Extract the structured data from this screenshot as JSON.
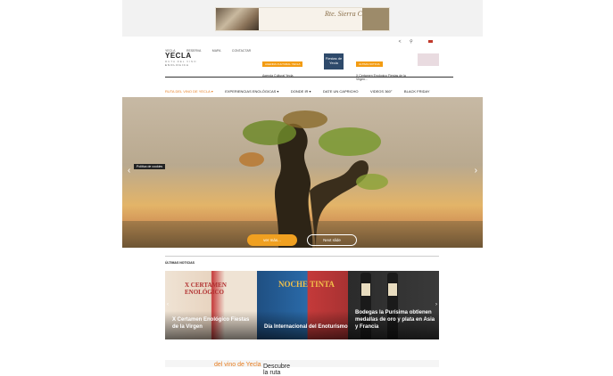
{
  "ad": {
    "title": "Rte. Sierra Cazorla",
    "subtitle": "",
    "logo_text": ""
  },
  "topnav": [
    "YECLA",
    "RESERVA",
    "MAPA",
    "CONTACTAR"
  ],
  "topicons": [
    "share-icon",
    "search-icon",
    "flag-icon"
  ],
  "logo": {
    "main": "YECLA",
    "sub": "RUTA DEL VINO",
    "sub2": "ENOLOGICA"
  },
  "promo1": {
    "tag": "AGENDA CULTURAL YECLA",
    "text": "Agenda Cultural Yecla"
  },
  "fiestas": {
    "text": "Fiestas de Yecla"
  },
  "promo2": {
    "tag": "ULTIMA NOTICIA",
    "text": "X Certamen Enologico Fiestas de la Virgen..."
  },
  "mainnav": [
    {
      "label": "RUTA DEL VINO DE YECLA ▾",
      "active": true
    },
    {
      "label": "EXPERIENCIAS ENOLÓGICAS ▾",
      "active": false
    },
    {
      "label": "DONDE IR ▾",
      "active": false
    },
    {
      "label": "DATE UN CAPRICHO",
      "active": false
    },
    {
      "label": "VIDEOS 360°",
      "active": false
    },
    {
      "label": "BLACK FRIDAY",
      "active": false
    }
  ],
  "hero": {
    "cookies": "Política de cookies",
    "more_button": "ver más...",
    "next_button": "Next slide"
  },
  "news": {
    "title": "ÚLTIMAS NOTICIAS",
    "cards": [
      {
        "label": "X Certamen Enológico Fiestas de la Virgen",
        "art": "X CERTAMEN ENOLÓGICO"
      },
      {
        "label": "Día Internacional del Enoturismo",
        "art": "NOCHE TINTA"
      },
      {
        "label": "Bodegas la Purísima obtienen medallas de oro y plata en Asia y Francia",
        "art": ""
      }
    ]
  },
  "footer": {
    "text1": "Descubre la ruta ",
    "text2": "del vino de Yecla"
  },
  "colors": {
    "accent": "#f0a020",
    "nav_active": "#e67e22",
    "dark": "#222222"
  }
}
